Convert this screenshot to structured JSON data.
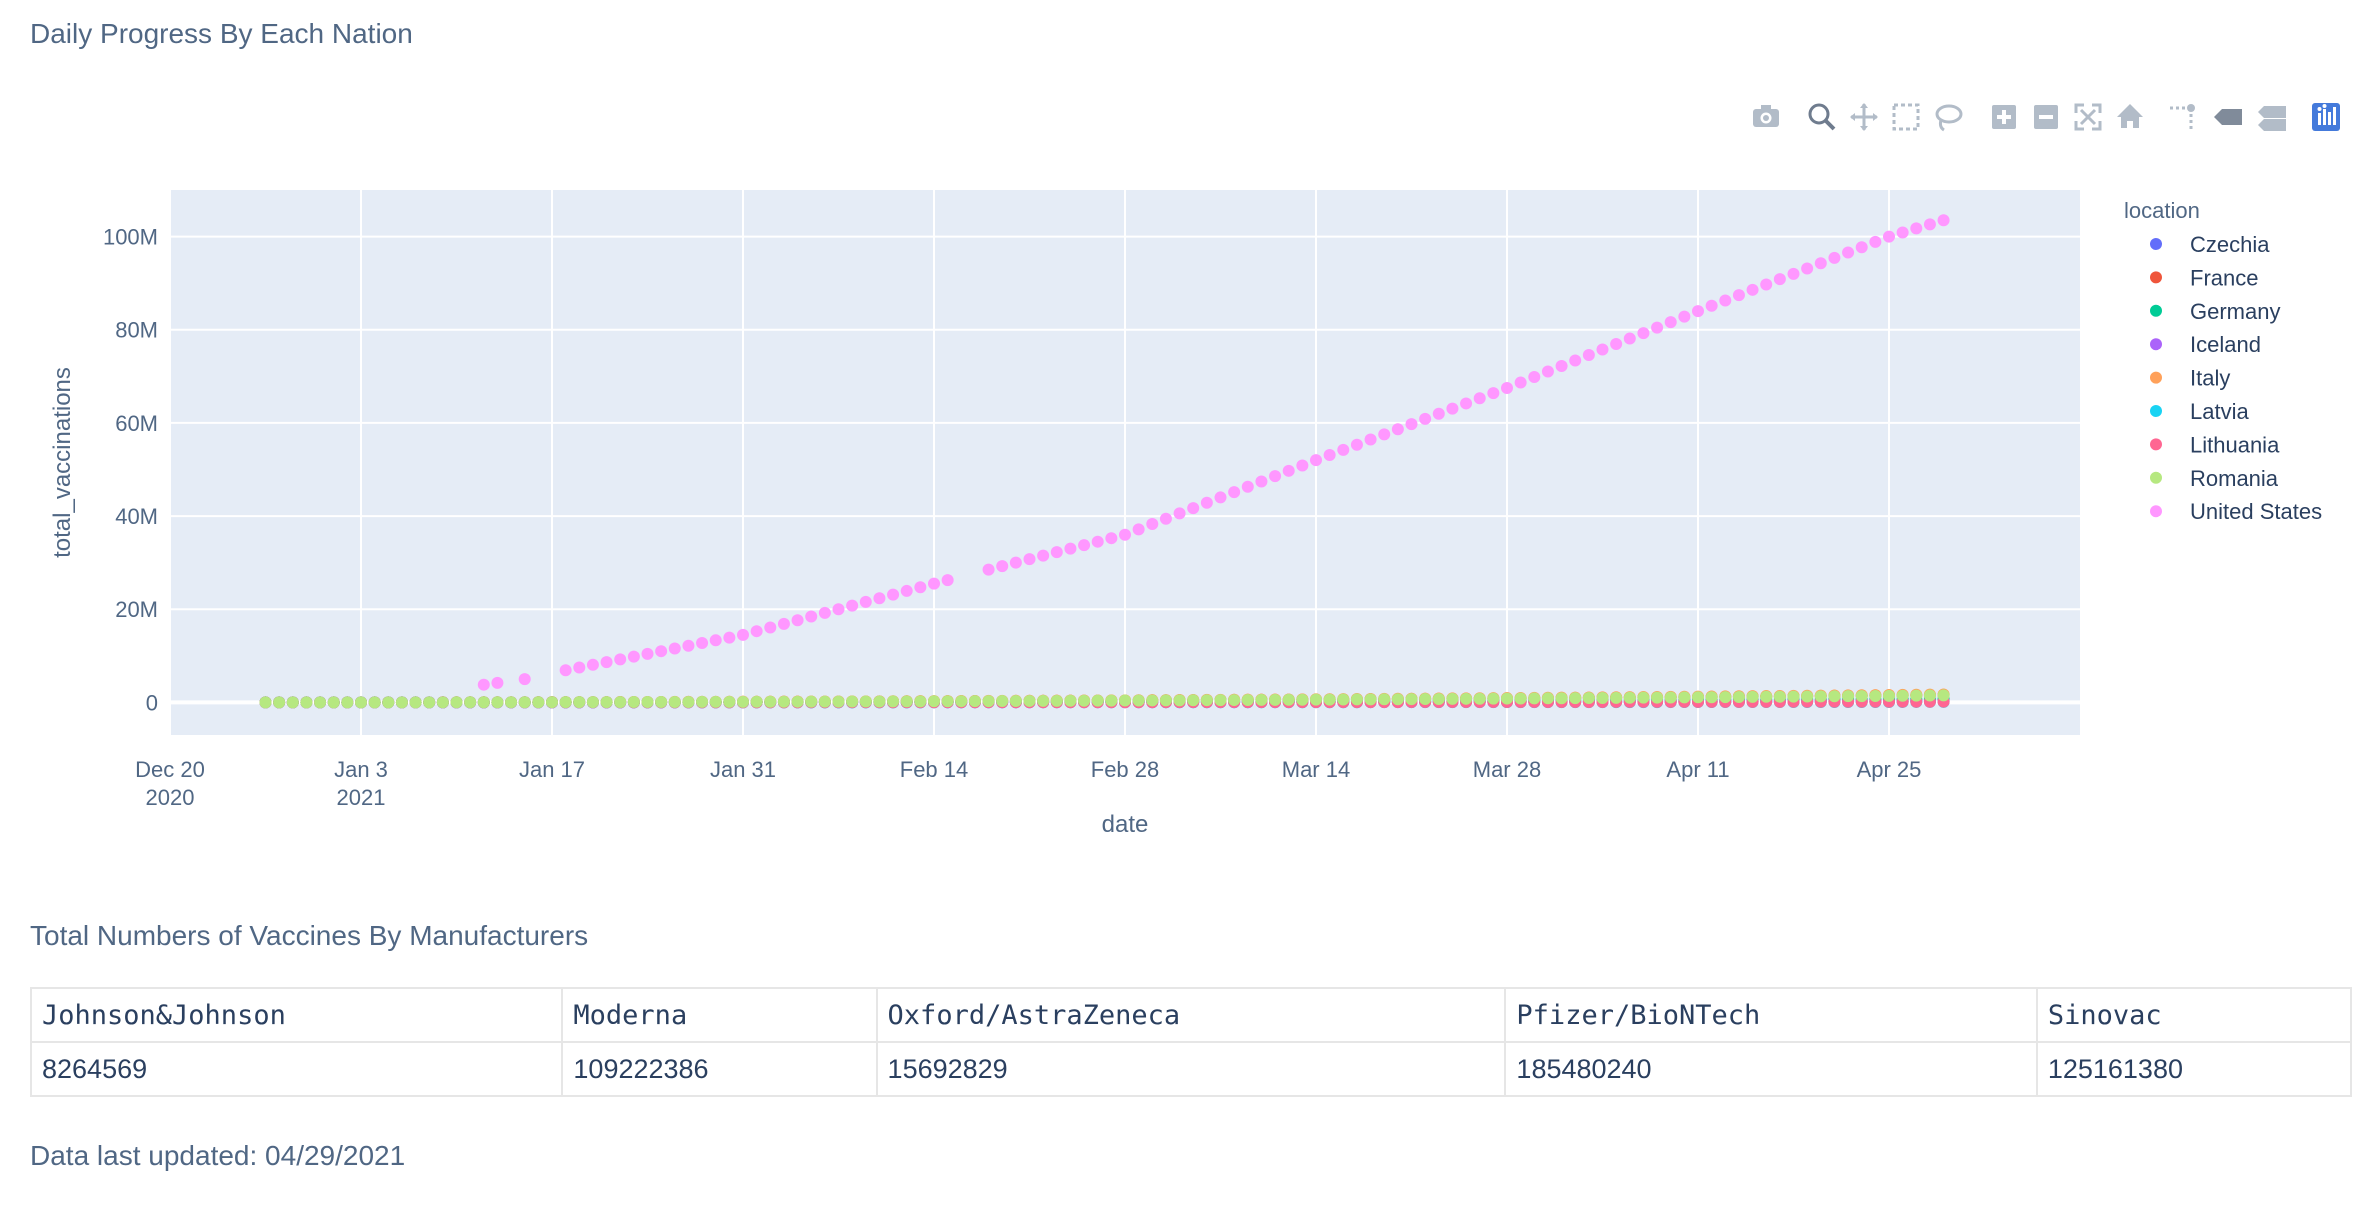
{
  "page": {
    "chart_title": "Daily Progress By Each Nation",
    "table_title": "Total Numbers of Vaccines By Manufacturers",
    "updated_text": "Data last updated: 04/29/2021"
  },
  "modebar": [
    {
      "name": "camera-icon",
      "title": "Download plot as a png"
    },
    {
      "name": "zoom-icon",
      "title": "Zoom"
    },
    {
      "name": "pan-icon",
      "title": "Pan"
    },
    {
      "name": "box-select-icon",
      "title": "Box Select"
    },
    {
      "name": "lasso-select-icon",
      "title": "Lasso Select"
    },
    {
      "name": "zoom-in-icon",
      "title": "Zoom in"
    },
    {
      "name": "zoom-out-icon",
      "title": "Zoom out"
    },
    {
      "name": "autoscale-icon",
      "title": "Autoscale"
    },
    {
      "name": "reset-axes-icon",
      "title": "Reset axes"
    },
    {
      "name": "spike-lines-icon",
      "title": "Toggle Spike Lines"
    },
    {
      "name": "hover-closest-icon",
      "title": "Show closest data on hover"
    },
    {
      "name": "hover-compare-icon",
      "title": "Compare data on hover"
    },
    {
      "name": "plotly-logo-icon",
      "title": "Produced with Plotly"
    }
  ],
  "chart_data": {
    "type": "scatter",
    "xlabel": "date",
    "ylabel": "total_vaccinations",
    "x_range": [
      "2020-12-20",
      "2021-05-09"
    ],
    "ylim": [
      -7000000,
      110000000
    ],
    "x_ticks": [
      {
        "date": "2020-12-20",
        "label": "Dec 20",
        "sublabel": "2020"
      },
      {
        "date": "2021-01-03",
        "label": "Jan 3",
        "sublabel": "2021"
      },
      {
        "date": "2021-01-17",
        "label": "Jan 17",
        "sublabel": ""
      },
      {
        "date": "2021-01-31",
        "label": "Jan 31",
        "sublabel": ""
      },
      {
        "date": "2021-02-14",
        "label": "Feb 14",
        "sublabel": ""
      },
      {
        "date": "2021-02-28",
        "label": "Feb 28",
        "sublabel": ""
      },
      {
        "date": "2021-03-14",
        "label": "Mar 14",
        "sublabel": ""
      },
      {
        "date": "2021-03-28",
        "label": "Mar 28",
        "sublabel": ""
      },
      {
        "date": "2021-04-11",
        "label": "Apr 11",
        "sublabel": ""
      },
      {
        "date": "2021-04-25",
        "label": "Apr 25",
        "sublabel": ""
      }
    ],
    "y_ticks": [
      {
        "value": 0,
        "label": "0"
      },
      {
        "value": 20000000,
        "label": "20M"
      },
      {
        "value": 40000000,
        "label": "40M"
      },
      {
        "value": 60000000,
        "label": "60M"
      },
      {
        "value": 80000000,
        "label": "80M"
      },
      {
        "value": 100000000,
        "label": "100M"
      }
    ],
    "grid": true,
    "legend_title": "location",
    "legend_position": "right",
    "series": [
      {
        "name": "Czechia",
        "color": "#636efa",
        "start": "2020-12-27",
        "end": "2021-04-29",
        "anchors": [
          [
            "2020-12-27",
            0
          ],
          [
            "2021-04-29",
            350000
          ]
        ]
      },
      {
        "name": "France",
        "color": "#EF553B",
        "start": "2020-12-27",
        "end": "2021-04-29",
        "anchors": [
          [
            "2020-12-27",
            0
          ],
          [
            "2021-04-29",
            1600000
          ]
        ]
      },
      {
        "name": "Germany",
        "color": "#00cc96",
        "start": "2020-12-27",
        "end": "2021-04-29",
        "anchors": [
          [
            "2020-12-27",
            0
          ],
          [
            "2021-04-29",
            700000
          ]
        ]
      },
      {
        "name": "Iceland",
        "color": "#ab63fa",
        "start": "2020-12-27",
        "end": "2021-04-29",
        "anchors": [
          [
            "2020-12-27",
            0
          ],
          [
            "2021-04-29",
            200000
          ]
        ]
      },
      {
        "name": "Italy",
        "color": "#FFA15A",
        "start": "2020-12-27",
        "end": "2021-04-29",
        "anchors": [
          [
            "2020-12-27",
            0
          ],
          [
            "2021-04-29",
            1700000
          ]
        ]
      },
      {
        "name": "Latvia",
        "color": "#19d3f3",
        "start": "2020-12-27",
        "end": "2021-04-29",
        "anchors": [
          [
            "2020-12-27",
            0
          ],
          [
            "2021-04-29",
            100000
          ]
        ]
      },
      {
        "name": "Lithuania",
        "color": "#FF6692",
        "start": "2020-12-27",
        "end": "2021-04-29",
        "anchors": [
          [
            "2020-12-27",
            0
          ],
          [
            "2021-04-29",
            150000
          ]
        ]
      },
      {
        "name": "Romania",
        "color": "#B6E880",
        "start": "2020-12-27",
        "end": "2021-04-29",
        "anchors": [
          [
            "2020-12-27",
            0
          ],
          [
            "2021-04-29",
            1500000
          ]
        ]
      },
      {
        "name": "United States",
        "color": "#FF97FF",
        "start": "2021-01-12",
        "end": "2021-04-29",
        "skip": [
          "2021-01-14",
          "2021-01-16",
          "2021-01-17",
          "2021-02-16",
          "2021-02-17"
        ],
        "anchors": [
          [
            "2021-01-12",
            3800000
          ],
          [
            "2021-01-15",
            5000000
          ],
          [
            "2021-01-18",
            6900000
          ],
          [
            "2021-01-31",
            14500000
          ],
          [
            "2021-02-14",
            25500000
          ],
          [
            "2021-02-28",
            36000000
          ],
          [
            "2021-03-14",
            52000000
          ],
          [
            "2021-03-28",
            67500000
          ],
          [
            "2021-04-11",
            84000000
          ],
          [
            "2021-04-25",
            100000000
          ],
          [
            "2021-04-29",
            103500000
          ]
        ]
      }
    ]
  },
  "manufacturers": {
    "headers": [
      "Johnson&Johnson",
      "Moderna",
      "Oxford/AstraZeneca",
      "Pfizer/BioNTech",
      "Sinovac"
    ],
    "values": [
      "8264569",
      "109222386",
      "15692829",
      "185480240",
      "125161380"
    ]
  }
}
